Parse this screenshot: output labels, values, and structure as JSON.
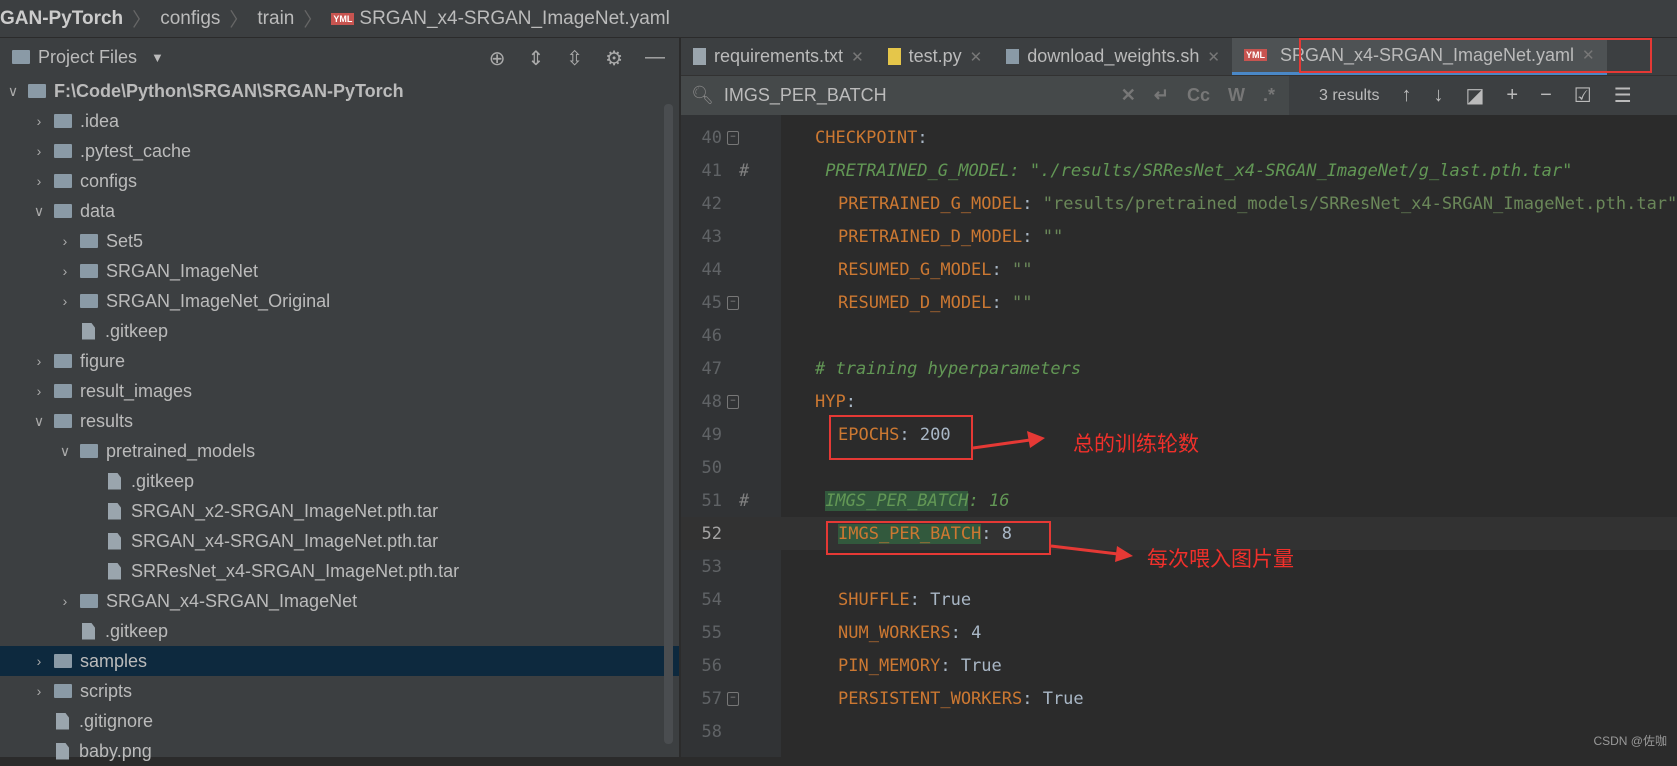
{
  "breadcrumb": [
    "GAN-PyTorch",
    "configs",
    "train",
    "SRGAN_x4-SRGAN_ImageNet.yaml"
  ],
  "sidebar": {
    "title": "Project Files",
    "icons": [
      "locate-icon",
      "expand-all-icon",
      "collapse-all-icon",
      "gear-icon",
      "minimize-icon"
    ],
    "items": [
      {
        "label": "F:\\Code\\Python\\SRGAN\\SRGAN-PyTorch",
        "type": "folder",
        "depth": 0,
        "open": true
      },
      {
        "label": ".idea",
        "type": "folder",
        "depth": 1
      },
      {
        "label": ".pytest_cache",
        "type": "folder",
        "depth": 1
      },
      {
        "label": "configs",
        "type": "folder",
        "depth": 1
      },
      {
        "label": "data",
        "type": "folder",
        "depth": 1,
        "open": true
      },
      {
        "label": "Set5",
        "type": "folder",
        "depth": 2
      },
      {
        "label": "SRGAN_ImageNet",
        "type": "folder",
        "depth": 2
      },
      {
        "label": "SRGAN_ImageNet_Original",
        "type": "folder",
        "depth": 2
      },
      {
        "label": ".gitkeep",
        "type": "file",
        "depth": 2
      },
      {
        "label": "figure",
        "type": "folder",
        "depth": 1
      },
      {
        "label": "result_images",
        "type": "folder",
        "depth": 1
      },
      {
        "label": "results",
        "type": "folder",
        "depth": 1,
        "open": true
      },
      {
        "label": "pretrained_models",
        "type": "folder",
        "depth": 2,
        "open": true
      },
      {
        "label": ".gitkeep",
        "type": "file",
        "depth": 3
      },
      {
        "label": "SRGAN_x2-SRGAN_ImageNet.pth.tar",
        "type": "file",
        "depth": 3
      },
      {
        "label": "SRGAN_x4-SRGAN_ImageNet.pth.tar",
        "type": "file",
        "depth": 3
      },
      {
        "label": "SRResNet_x4-SRGAN_ImageNet.pth.tar",
        "type": "file",
        "depth": 3
      },
      {
        "label": "SRGAN_x4-SRGAN_ImageNet",
        "type": "folder",
        "depth": 2
      },
      {
        "label": ".gitkeep",
        "type": "file",
        "depth": 2
      },
      {
        "label": "samples",
        "type": "folder",
        "depth": 1,
        "selected": true
      },
      {
        "label": "scripts",
        "type": "folder",
        "depth": 1
      },
      {
        "label": ".gitignore",
        "type": "file",
        "depth": 1
      },
      {
        "label": "baby.png",
        "type": "file",
        "depth": 1
      }
    ]
  },
  "tabs": [
    {
      "label": "requirements.txt"
    },
    {
      "label": "test.py"
    },
    {
      "label": "download_weights.sh"
    },
    {
      "label": "SRGAN_x4-SRGAN_ImageNet.yaml",
      "active": true
    }
  ],
  "search": {
    "query": "IMGS_PER_BATCH",
    "results": "3 results",
    "options": [
      "Cc",
      "W",
      ".*"
    ]
  },
  "code": [
    {
      "n": "40",
      "parts": [
        [
          "k",
          "CHECKPOINT"
        ],
        [
          "p",
          ":"
        ]
      ],
      "indent": 0
    },
    {
      "n": "41",
      "parts": [
        [
          "cg",
          "#    "
        ],
        [
          "c",
          "PRETRAINED_G_MODEL: \"./results/SRResNet_x4-SRGAN_ImageNet/g_last.pth.tar\""
        ]
      ],
      "indent": -1
    },
    {
      "n": "42",
      "parts": [
        [
          "k",
          "PRETRAINED_G_MODEL"
        ],
        [
          "p",
          ": "
        ],
        [
          "s",
          "\"results/pretrained_models/SRResNet_x4-SRGAN_ImageNet.pth.tar\""
        ]
      ],
      "indent": 1
    },
    {
      "n": "43",
      "parts": [
        [
          "k",
          "PRETRAINED_D_MODEL"
        ],
        [
          "p",
          ": "
        ],
        [
          "s",
          "\"\""
        ]
      ],
      "indent": 1
    },
    {
      "n": "44",
      "parts": [
        [
          "k",
          "RESUMED_G_MODEL"
        ],
        [
          "p",
          ": "
        ],
        [
          "s",
          "\"\""
        ]
      ],
      "indent": 1
    },
    {
      "n": "45",
      "parts": [
        [
          "k",
          "RESUMED_D_MODEL"
        ],
        [
          "p",
          ": "
        ],
        [
          "s",
          "\"\""
        ]
      ],
      "indent": 1
    },
    {
      "n": "46",
      "parts": [],
      "indent": 0
    },
    {
      "n": "47",
      "parts": [
        [
          "c",
          "# training hyperparameters"
        ]
      ],
      "indent": 0
    },
    {
      "n": "48",
      "parts": [
        [
          "k",
          "HYP"
        ],
        [
          "p",
          ":"
        ]
      ],
      "indent": 0
    },
    {
      "n": "49",
      "parts": [
        [
          "k",
          "EPOCHS"
        ],
        [
          "p",
          ": 200"
        ]
      ],
      "indent": 1
    },
    {
      "n": "50",
      "parts": [],
      "indent": 0
    },
    {
      "n": "51",
      "parts": [
        [
          "cg",
          "#    "
        ],
        [
          "c hl",
          "IMGS_PER_BATCH"
        ],
        [
          "c",
          ": 16"
        ]
      ],
      "indent": -1
    },
    {
      "n": "52",
      "parts": [
        [
          "k hl",
          "IMGS_PER_BATCH"
        ],
        [
          "p",
          ": 8"
        ]
      ],
      "indent": 1,
      "current": true
    },
    {
      "n": "53",
      "parts": [],
      "indent": 0
    },
    {
      "n": "54",
      "parts": [
        [
          "k",
          "SHUFFLE"
        ],
        [
          "p",
          ": True"
        ]
      ],
      "indent": 1
    },
    {
      "n": "55",
      "parts": [
        [
          "k",
          "NUM_WORKERS"
        ],
        [
          "p",
          ": 4"
        ]
      ],
      "indent": 1
    },
    {
      "n": "56",
      "parts": [
        [
          "k",
          "PIN_MEMORY"
        ],
        [
          "p",
          ": True"
        ]
      ],
      "indent": 1
    },
    {
      "n": "57",
      "parts": [
        [
          "k",
          "PERSISTENT_WORKERS"
        ],
        [
          "p",
          ": True"
        ]
      ],
      "indent": 1
    },
    {
      "n": "58",
      "parts": [],
      "indent": 0
    }
  ],
  "annotations": {
    "epochs": "总的训练轮数",
    "batch": "每次喂入图片量",
    "color": "#e53935"
  },
  "watermark": "CSDN @佐咖"
}
